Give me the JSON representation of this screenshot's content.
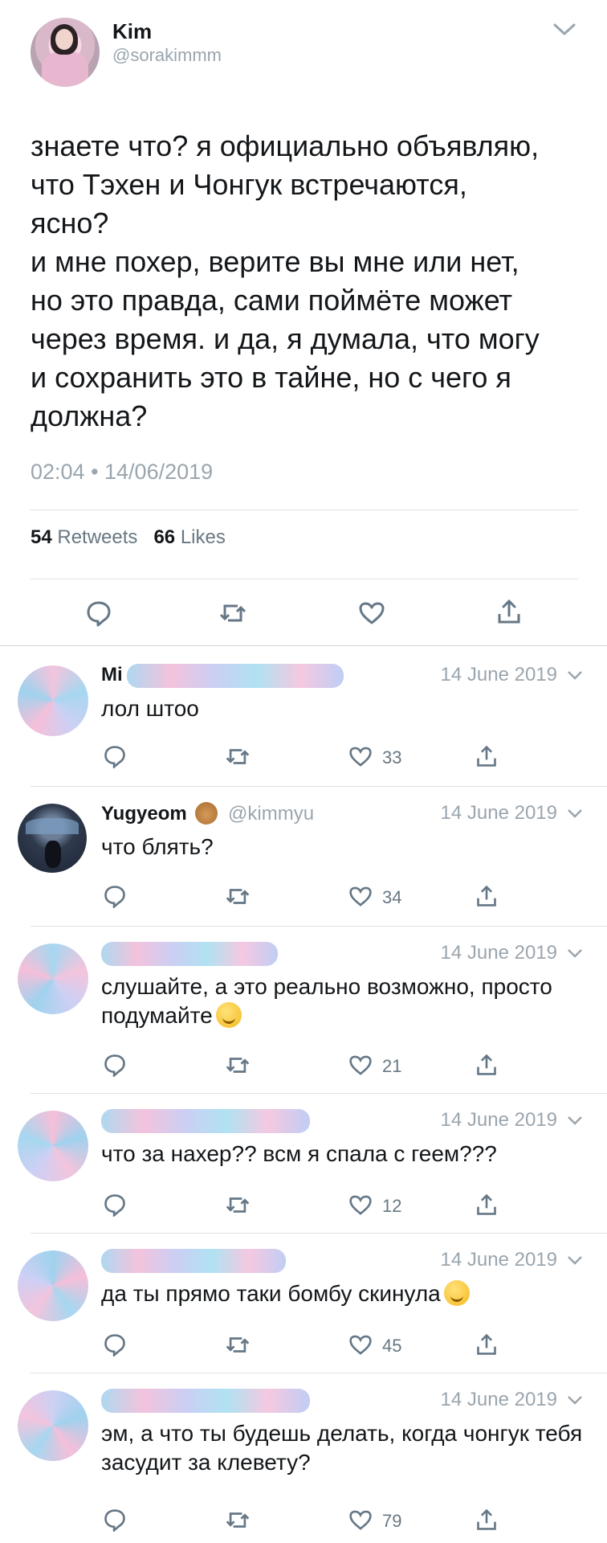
{
  "main_tweet": {
    "name": "Kim",
    "handle": "@sorakimmm",
    "text": "знаете что? я официально объявляю,\nчто Тэхен и Чонгук встречаются,\nясно?\nи мне похер, верите вы мне или нет,\nно это правда, сами поймёте может\nчерез время. и да, я думала, что могу\nи сохранить это в тайне, но с чего я\nдолжна?",
    "timestamp": "02:04 • 14/06/2019",
    "retweets_count": "54",
    "retweets_label": "Retweets",
    "likes_count": "66",
    "likes_label": "Likes",
    "icons": [
      "reply-icon",
      "retweet-icon",
      "like-icon",
      "share-icon"
    ]
  },
  "replies": [
    {
      "name": "Mi",
      "handle": "",
      "date": "14 June 2019",
      "text": "лол штоо",
      "likes": "33",
      "avatar_hidden": true
    },
    {
      "name": "Yugyeom",
      "handle": "@kimmyu",
      "date": "14 June 2019",
      "text": "что блять?",
      "likes": "34",
      "avatar_hidden": false,
      "name_emoji": "teddy-bear-emoji"
    },
    {
      "name": "",
      "handle": "",
      "date": "14 June 2019",
      "text": "слушайте, а это реально возможно, просто подумайте",
      "likes": "21",
      "avatar_hidden": true,
      "text_emoji": "thinking-face-emoji"
    },
    {
      "name": "",
      "handle": "",
      "date": "14 June 2019",
      "text": "что за нахер?? всм я спала с геем???",
      "likes": "12",
      "avatar_hidden": true
    },
    {
      "name": "",
      "handle": "",
      "date": "14 June 2019",
      "text": "да ты прямо таки бомбу скинула",
      "likes": "45",
      "avatar_hidden": true,
      "text_emoji": "grinning-sweat-emoji"
    },
    {
      "name": "",
      "handle": "",
      "date": "14 June 2019",
      "text": "эм, а что ты будешь делать, когда чонгук тебя засудит за клевету?",
      "likes": "79",
      "avatar_hidden": true
    }
  ],
  "colors": {
    "text": "#14171a",
    "secondary": "#9aa5ae",
    "icon": "#657786",
    "divider": "#dfe3e7"
  }
}
